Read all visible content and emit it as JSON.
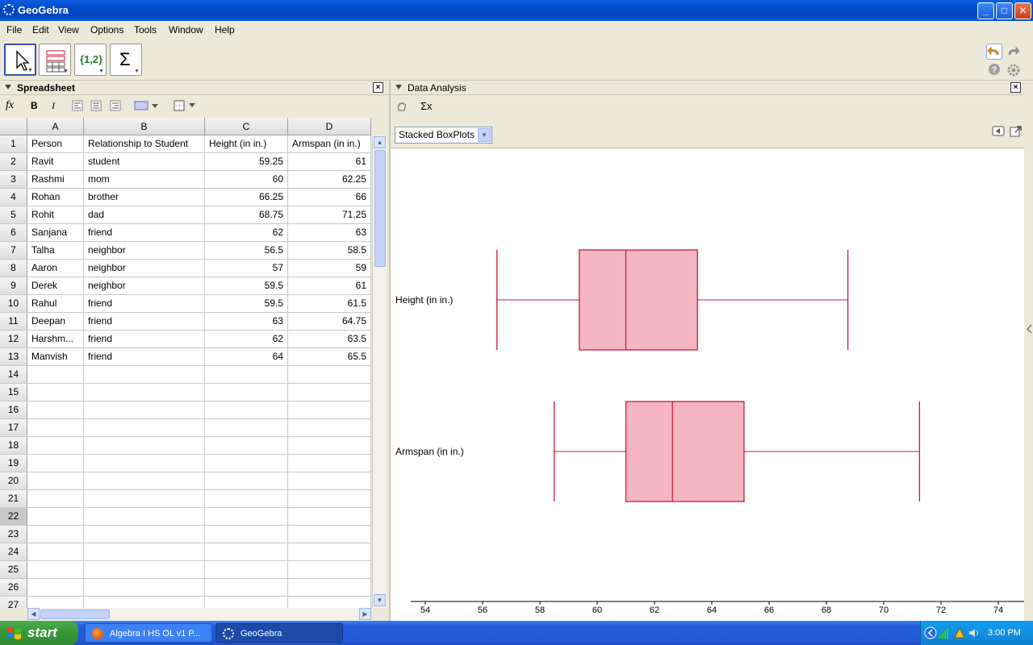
{
  "window": {
    "title": "GeoGebra"
  },
  "menu": [
    "File",
    "Edit",
    "View",
    "Options",
    "Tools",
    "Window",
    "Help"
  ],
  "toolbar": {
    "tools": [
      "move-tool",
      "two-variable-regression-tool",
      "list-tool",
      "sum-tool"
    ],
    "list_label": "{1,2}",
    "sum_label": "Σ"
  },
  "spreadsheet": {
    "title": "Spreadsheet",
    "close_label": "×",
    "fx_label": "fx",
    "bold_label": "B",
    "italic_label": "I",
    "columns": [
      "A",
      "B",
      "C",
      "D"
    ],
    "rows": [
      [
        "Person",
        "Relationship to Student",
        "Height (in in.)",
        "Armspan (in in.)"
      ],
      [
        "Ravit",
        "student",
        "59.25",
        "61"
      ],
      [
        "Rashmi",
        "mom",
        "60",
        "62.25"
      ],
      [
        "Rohan",
        "brother",
        "66.25",
        "66"
      ],
      [
        "Rohit",
        "dad",
        "68.75",
        "71.25"
      ],
      [
        "Sanjana",
        "friend",
        "62",
        "63"
      ],
      [
        "Talha",
        "neighbor",
        "56.5",
        "58.5"
      ],
      [
        "Aaron",
        "neighbor",
        "57",
        "59"
      ],
      [
        "Derek",
        "neighbor",
        "59.5",
        "61"
      ],
      [
        "Rahul",
        "friend",
        "59.5",
        "61.5"
      ],
      [
        "Deepan",
        "friend",
        "63",
        "64.75"
      ],
      [
        "Harshm...",
        "friend",
        "62",
        "63.5"
      ],
      [
        "Manvish",
        "friend",
        "64",
        "65.5"
      ]
    ],
    "row_numbers": [
      "1",
      "2",
      "3",
      "4",
      "5",
      "6",
      "7",
      "8",
      "9",
      "10",
      "11",
      "12",
      "13",
      "14",
      "15",
      "16",
      "17",
      "18",
      "19",
      "20",
      "21",
      "22",
      "23",
      "24",
      "25",
      "26",
      "27"
    ],
    "selected_row": "22"
  },
  "data_analysis": {
    "title": "Data Analysis",
    "close_label": "×",
    "stats_label": "Σx",
    "plot_type": "Stacked BoxPlots"
  },
  "chart_data": {
    "type": "boxplot",
    "xlim": [
      53.5,
      74.5
    ],
    "xticks": [
      54,
      56,
      58,
      60,
      62,
      64,
      66,
      68,
      70,
      72,
      74
    ],
    "color": "#c41e3a",
    "fill": "#f4b6c2",
    "series": [
      {
        "name": "Height (in in.)",
        "min": 56.5,
        "q1": 59.375,
        "median": 61,
        "q3": 63.5,
        "max": 68.75
      },
      {
        "name": "Armspan (in in.)",
        "min": 58.5,
        "q1": 61,
        "median": 62.625,
        "q3": 65.125,
        "max": 71.25
      }
    ]
  },
  "taskbar": {
    "start_label": "start",
    "tasks": [
      "Algebra I HS OL v1 P...",
      "GeoGebra"
    ],
    "clock": "3:00 PM"
  }
}
